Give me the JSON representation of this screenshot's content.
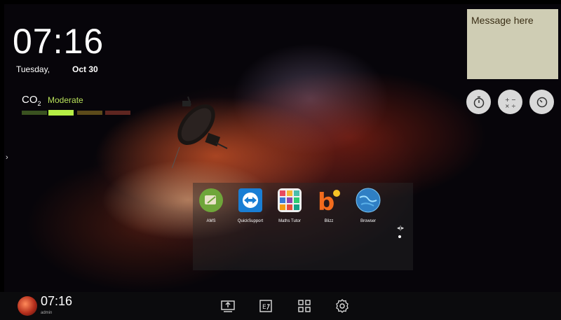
{
  "clock": {
    "time": "07:16",
    "day": "Tuesday,",
    "date": "Oct 30"
  },
  "co2": {
    "label_main": "CO",
    "label_sub": "2",
    "level": "Moderate",
    "level_color": "#b8e05a"
  },
  "note": {
    "text": "Message here"
  },
  "tools": [
    {
      "name": "stopwatch",
      "icon": "stopwatch-icon"
    },
    {
      "name": "calculator",
      "icon": "calculator-icon"
    },
    {
      "name": "timer",
      "icon": "timer-icon"
    }
  ],
  "apps": [
    {
      "label": "AMS",
      "icon": "ams-icon"
    },
    {
      "label": "QuickSupport",
      "icon": "quicksupport-icon"
    },
    {
      "label": "Maths Tutor",
      "icon": "maths-tutor-icon"
    },
    {
      "label": "Blizz",
      "icon": "blizz-icon"
    },
    {
      "label": "Browser",
      "icon": "browser-icon"
    }
  ],
  "taskbar": {
    "time": "07:16",
    "user": "admin",
    "buttons": [
      "source-input-icon",
      "whiteboard-icon",
      "apps-grid-icon",
      "settings-gear-icon"
    ]
  }
}
